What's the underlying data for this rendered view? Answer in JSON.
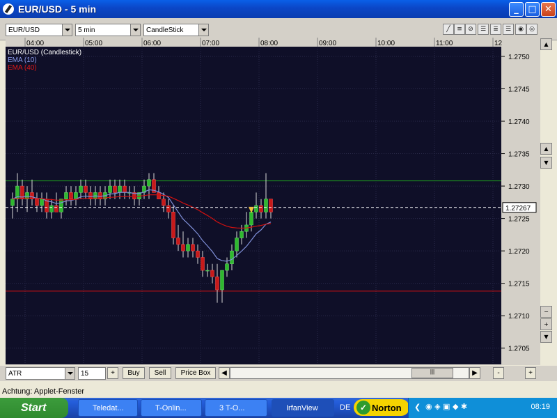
{
  "window": {
    "title": "EUR/USD - 5 min",
    "min_label": "_",
    "max_label": "□",
    "close_label": "✕"
  },
  "toolbar": {
    "symbol": "EUR/USD",
    "interval": "5 min",
    "chart_type": "CandleStick"
  },
  "legend": {
    "title": "EUR/USD (Candlestick)",
    "ema10": "EMA (10)",
    "ema40": "EMA (40)",
    "ema10_color": "#7f8fd8",
    "ema40_color": "#d01010"
  },
  "time_axis": [
    "04:00",
    "05:00",
    "06:00",
    "07:00",
    "08:00",
    "09:00",
    "10:00",
    "11:00",
    "12"
  ],
  "price_axis": [
    "1.2750",
    "1.2745",
    "1.2740",
    "1.2735",
    "1.2730",
    "1.2725",
    "1.2720",
    "1.2715",
    "1.2710",
    "1.2705"
  ],
  "current_price": "1.27267",
  "bottom": {
    "indicator": "ATR",
    "period": "15",
    "plus": "+",
    "buy": "Buy",
    "sell": "Sell",
    "price_box": "Price Box",
    "minus": "-",
    "plus2": "+"
  },
  "status": "Achtung: Applet-Fenster",
  "taskbar": {
    "start": "Start",
    "tasks": [
      "Teledat...",
      "T-Onlin...",
      "3 T-O...",
      "IrfanView"
    ],
    "norton": "Norton",
    "lang": "DE",
    "clock": "08:19"
  },
  "chart_data": {
    "type": "candlestick",
    "title": "EUR/USD (Candlestick)",
    "interval": "5 min",
    "x_ticks": [
      "04:00",
      "05:00",
      "06:00",
      "07:00",
      "08:00",
      "09:00",
      "10:00",
      "11:00",
      "12"
    ],
    "ylim": [
      1.27025,
      1.27515
    ],
    "y_ticks": [
      1.275,
      1.2745,
      1.274,
      1.2735,
      1.273,
      1.2725,
      1.272,
      1.2715,
      1.271,
      1.2705
    ],
    "current_price": 1.27267,
    "horizontal_lines": [
      {
        "value": 1.27308,
        "color": "#1fa01f"
      },
      {
        "value": 1.27138,
        "color": "#d01010"
      }
    ],
    "candles": [
      {
        "o": 1.2727,
        "h": 1.2729,
        "l": 1.2725,
        "c": 1.2728
      },
      {
        "o": 1.2728,
        "h": 1.2732,
        "l": 1.2726,
        "c": 1.273
      },
      {
        "o": 1.273,
        "h": 1.2731,
        "l": 1.2727,
        "c": 1.2728
      },
      {
        "o": 1.2728,
        "h": 1.273,
        "l": 1.2726,
        "c": 1.2729
      },
      {
        "o": 1.2729,
        "h": 1.2731,
        "l": 1.2727,
        "c": 1.2728
      },
      {
        "o": 1.2728,
        "h": 1.2729,
        "l": 1.2726,
        "c": 1.2727
      },
      {
        "o": 1.2727,
        "h": 1.2729,
        "l": 1.2726,
        "c": 1.2728
      },
      {
        "o": 1.2728,
        "h": 1.2729,
        "l": 1.2725,
        "c": 1.2726
      },
      {
        "o": 1.2726,
        "h": 1.2728,
        "l": 1.2725,
        "c": 1.2727
      },
      {
        "o": 1.2727,
        "h": 1.2729,
        "l": 1.2726,
        "c": 1.2726
      },
      {
        "o": 1.2726,
        "h": 1.2728,
        "l": 1.2725,
        "c": 1.2728
      },
      {
        "o": 1.2728,
        "h": 1.273,
        "l": 1.2727,
        "c": 1.2729
      },
      {
        "o": 1.2729,
        "h": 1.273,
        "l": 1.2727,
        "c": 1.2728
      },
      {
        "o": 1.2728,
        "h": 1.273,
        "l": 1.2727,
        "c": 1.2729
      },
      {
        "o": 1.2729,
        "h": 1.2731,
        "l": 1.2728,
        "c": 1.273
      },
      {
        "o": 1.273,
        "h": 1.2731,
        "l": 1.2728,
        "c": 1.2729
      },
      {
        "o": 1.2729,
        "h": 1.273,
        "l": 1.2727,
        "c": 1.2728
      },
      {
        "o": 1.2728,
        "h": 1.273,
        "l": 1.2727,
        "c": 1.2729
      },
      {
        "o": 1.2729,
        "h": 1.273,
        "l": 1.2727,
        "c": 1.2728
      },
      {
        "o": 1.2728,
        "h": 1.273,
        "l": 1.2727,
        "c": 1.2729
      },
      {
        "o": 1.2729,
        "h": 1.2731,
        "l": 1.2728,
        "c": 1.273
      },
      {
        "o": 1.273,
        "h": 1.2731,
        "l": 1.2728,
        "c": 1.2729
      },
      {
        "o": 1.2729,
        "h": 1.2731,
        "l": 1.2728,
        "c": 1.273
      },
      {
        "o": 1.273,
        "h": 1.2731,
        "l": 1.2728,
        "c": 1.2729
      },
      {
        "o": 1.2729,
        "h": 1.273,
        "l": 1.2728,
        "c": 1.2729
      },
      {
        "o": 1.2729,
        "h": 1.273,
        "l": 1.2727,
        "c": 1.2728
      },
      {
        "o": 1.2728,
        "h": 1.2729,
        "l": 1.2727,
        "c": 1.2729
      },
      {
        "o": 1.2729,
        "h": 1.2731,
        "l": 1.2728,
        "c": 1.273
      },
      {
        "o": 1.273,
        "h": 1.2732,
        "l": 1.2728,
        "c": 1.2731
      },
      {
        "o": 1.2731,
        "h": 1.2732,
        "l": 1.2729,
        "c": 1.2729
      },
      {
        "o": 1.2729,
        "h": 1.273,
        "l": 1.2728,
        "c": 1.2728
      },
      {
        "o": 1.2728,
        "h": 1.2729,
        "l": 1.2726,
        "c": 1.2727
      },
      {
        "o": 1.2727,
        "h": 1.2728,
        "l": 1.2725,
        "c": 1.2726
      },
      {
        "o": 1.2726,
        "h": 1.2727,
        "l": 1.2721,
        "c": 1.2722
      },
      {
        "o": 1.2722,
        "h": 1.2724,
        "l": 1.272,
        "c": 1.2721
      },
      {
        "o": 1.2721,
        "h": 1.2723,
        "l": 1.2719,
        "c": 1.272
      },
      {
        "o": 1.272,
        "h": 1.2722,
        "l": 1.2719,
        "c": 1.2721
      },
      {
        "o": 1.2721,
        "h": 1.2722,
        "l": 1.2719,
        "c": 1.272
      },
      {
        "o": 1.272,
        "h": 1.2721,
        "l": 1.2718,
        "c": 1.2719
      },
      {
        "o": 1.2719,
        "h": 1.272,
        "l": 1.2716,
        "c": 1.2717
      },
      {
        "o": 1.2717,
        "h": 1.2718,
        "l": 1.2716,
        "c": 1.2717
      },
      {
        "o": 1.2717,
        "h": 1.2718,
        "l": 1.2715,
        "c": 1.2716
      },
      {
        "o": 1.2716,
        "h": 1.2718,
        "l": 1.2712,
        "c": 1.2714
      },
      {
        "o": 1.2714,
        "h": 1.2717,
        "l": 1.2712,
        "c": 1.2717
      },
      {
        "o": 1.2717,
        "h": 1.2719,
        "l": 1.2716,
        "c": 1.2718
      },
      {
        "o": 1.2718,
        "h": 1.2721,
        "l": 1.2717,
        "c": 1.272
      },
      {
        "o": 1.272,
        "h": 1.2723,
        "l": 1.2719,
        "c": 1.2722
      },
      {
        "o": 1.2722,
        "h": 1.2724,
        "l": 1.2721,
        "c": 1.2723
      },
      {
        "o": 1.2723,
        "h": 1.2726,
        "l": 1.2722,
        "c": 1.2724
      },
      {
        "o": 1.2724,
        "h": 1.2726,
        "l": 1.2723,
        "c": 1.2726
      },
      {
        "o": 1.2726,
        "h": 1.2729,
        "l": 1.2725,
        "c": 1.2727
      },
      {
        "o": 1.2727,
        "h": 1.2728,
        "l": 1.2725,
        "c": 1.2726
      },
      {
        "o": 1.2726,
        "h": 1.2732,
        "l": 1.2725,
        "c": 1.2728
      },
      {
        "o": 1.2728,
        "h": 1.2728,
        "l": 1.2725,
        "c": 1.2726
      }
    ]
  }
}
